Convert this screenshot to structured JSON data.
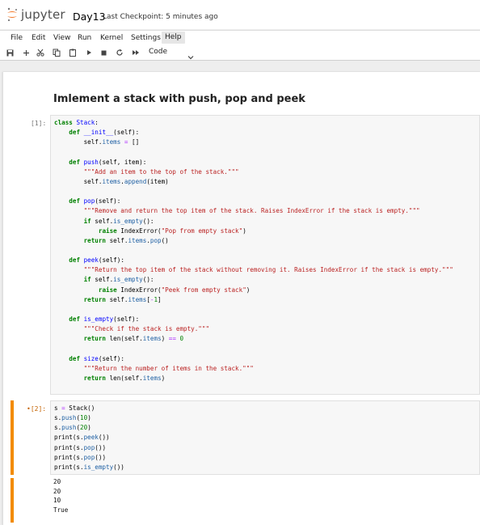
{
  "header": {
    "logo_text": "jupyter",
    "notebook_title": "Day13",
    "checkpoint": "Last Checkpoint: 5 minutes ago"
  },
  "menubar": {
    "items": [
      "File",
      "Edit",
      "View",
      "Run",
      "Kernel",
      "Settings",
      "Help"
    ],
    "active": "Help"
  },
  "toolbar": {
    "cell_type": "Code",
    "icons": [
      "save-icon",
      "add-cell-icon",
      "cut-icon",
      "copy-icon",
      "paste-icon",
      "run-icon",
      "stop-icon",
      "restart-icon",
      "fast-forward-icon",
      "chevron-down-icon"
    ]
  },
  "cells": {
    "heading": "Imlement a stack with push, pop and peek",
    "cell1": {
      "prompt": "[1]:",
      "lines": [
        "class Stack:",
        "    def __init__(self):",
        "        self.items = []",
        "",
        "    def push(self, item):",
        "        \"\"\"Add an item to the top of the stack.\"\"\"",
        "        self.items.append(item)",
        "",
        "    def pop(self):",
        "        \"\"\"Remove and return the top item of the stack. Raises IndexError if the stack is empty.\"\"\"",
        "        if self.is_empty():",
        "            raise IndexError(\"Pop from empty stack\")",
        "        return self.items.pop()",
        "",
        "    def peek(self):",
        "        \"\"\"Return the top item of the stack without removing it. Raises IndexError if the stack is empty.\"\"\"",
        "        if self.is_empty():",
        "            raise IndexError(\"Peek from empty stack\")",
        "        return self.items[-1]",
        "",
        "    def is_empty(self):",
        "        \"\"\"Check if the stack is empty.\"\"\"",
        "        return len(self.items) == 0",
        "",
        "    def size(self):",
        "        \"\"\"Return the number of items in the stack.\"\"\"",
        "        return len(self.items)"
      ]
    },
    "cell2": {
      "prompt": "•[2]:",
      "lines": [
        "s = Stack()",
        "s.push(10)",
        "s.push(20)",
        "print(s.peek())",
        "print(s.pop())",
        "print(s.pop())",
        "print(s.is_empty())"
      ],
      "outputs": [
        "20",
        "20",
        "10",
        "True"
      ]
    }
  },
  "colors": {
    "accent": "#f28b00",
    "logo_orange": "#f37726"
  }
}
